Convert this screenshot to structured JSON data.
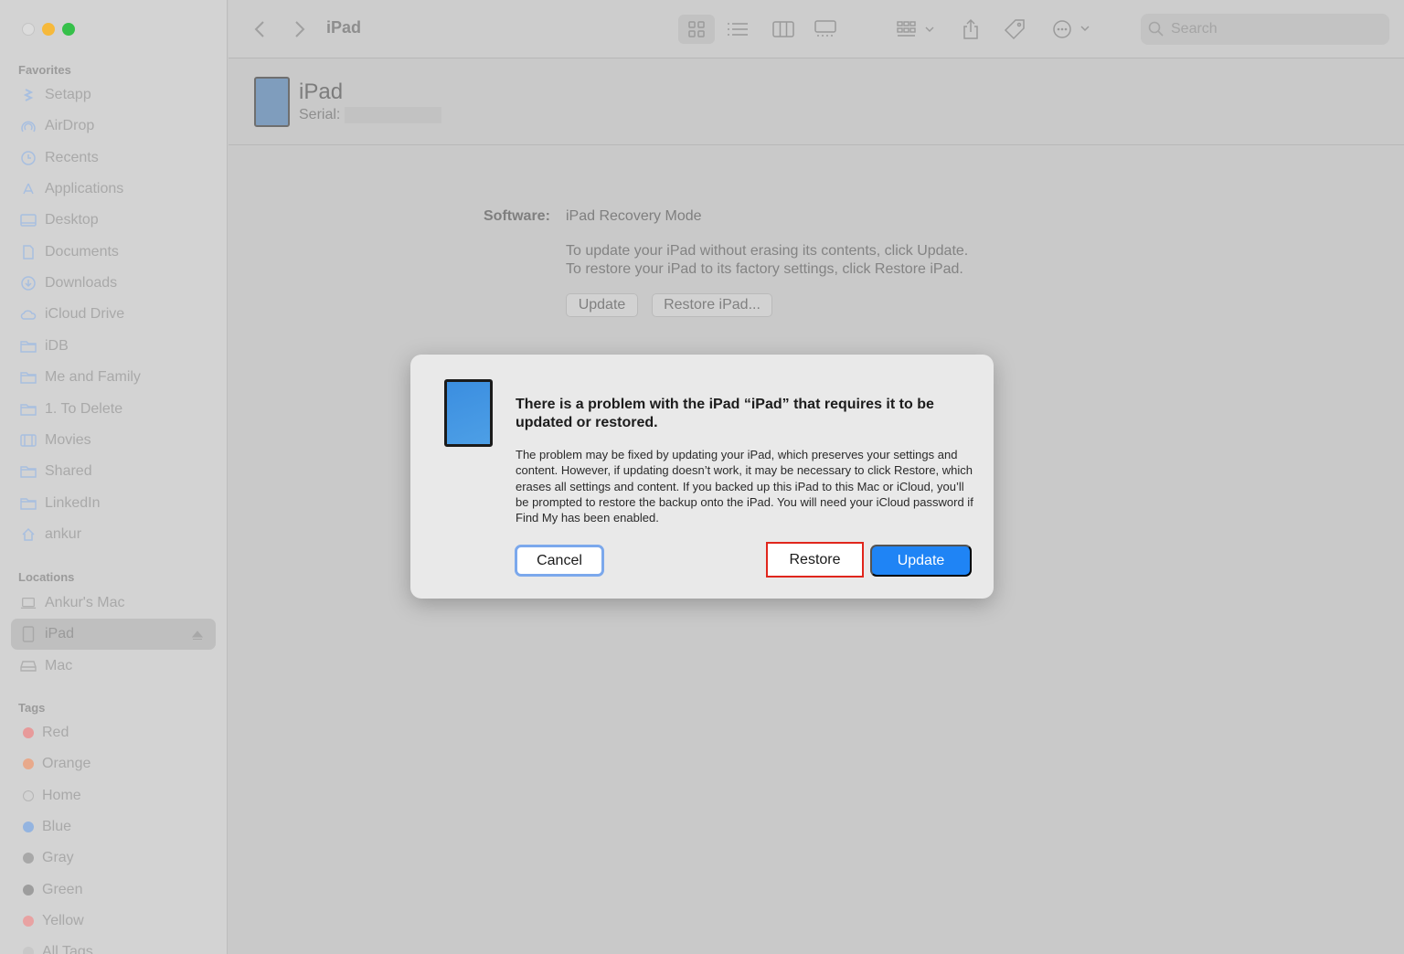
{
  "window": {
    "title": "iPad"
  },
  "toolbar": {
    "search_placeholder": "Search"
  },
  "sidebar": {
    "favorites_title": "Favorites",
    "favorites": [
      {
        "label": "Setapp",
        "icon": "setapp-icon"
      },
      {
        "label": "AirDrop",
        "icon": "airdrop-icon"
      },
      {
        "label": "Recents",
        "icon": "clock-icon"
      },
      {
        "label": "Applications",
        "icon": "applications-icon"
      },
      {
        "label": "Desktop",
        "icon": "desktop-icon"
      },
      {
        "label": "Documents",
        "icon": "document-icon"
      },
      {
        "label": "Downloads",
        "icon": "download-icon"
      },
      {
        "label": "iCloud Drive",
        "icon": "cloud-icon"
      },
      {
        "label": "iDB",
        "icon": "folder-icon"
      },
      {
        "label": "Me and Family",
        "icon": "folder-icon"
      },
      {
        "label": "1. To Delete",
        "icon": "folder-icon"
      },
      {
        "label": "Movies",
        "icon": "film-icon"
      },
      {
        "label": "Shared",
        "icon": "folder-icon"
      },
      {
        "label": "LinkedIn",
        "icon": "folder-icon"
      },
      {
        "label": "ankur",
        "icon": "home-icon"
      }
    ],
    "locations_title": "Locations",
    "locations": [
      {
        "label": "Ankur's Mac",
        "icon": "laptop-icon"
      },
      {
        "label": "iPad",
        "icon": "ipad-icon",
        "selected": true
      },
      {
        "label": "Mac",
        "icon": "disk-icon"
      }
    ],
    "tags_title": "Tags",
    "tags": [
      {
        "label": "Red",
        "color": "#e79a9a"
      },
      {
        "label": "Orange",
        "color": "#e8a98b"
      },
      {
        "label": "Home",
        "color": "none"
      },
      {
        "label": "Blue",
        "color": "#94b4e0"
      },
      {
        "label": "Gray",
        "color": "#a8a8a8"
      },
      {
        "label": "Green",
        "color": "#9d9d9d"
      },
      {
        "label": "Yellow",
        "color": "#e8a2a2"
      },
      {
        "label": "All Tags...",
        "color": "#c8c8c8"
      }
    ]
  },
  "device": {
    "name": "iPad",
    "serial_label": "Serial:"
  },
  "software": {
    "label": "Software:",
    "value": "iPad Recovery Mode",
    "line1": "To update your iPad without erasing its contents, click Update.",
    "line2": "To restore your iPad to its factory settings, click Restore iPad.",
    "update_button": "Update",
    "restore_button": "Restore iPad..."
  },
  "dialog": {
    "title": "There is a problem with the iPad “iPad” that requires it to be updated or restored.",
    "body": "The problem may be fixed by updating your iPad, which preserves your settings and content. However, if updating doesn’t work, it may be necessary to click Restore, which erases all settings and content. If you backed up this iPad to this Mac or iCloud, you’ll be prompted to restore the backup onto the iPad. You will need your iCloud password if Find My has been enabled.",
    "cancel": "Cancel",
    "restore": "Restore",
    "update": "Update"
  },
  "colors": {
    "accent": "#1f84f5",
    "highlight": "#e0261c",
    "focus_ring": "#7ba8ec"
  }
}
